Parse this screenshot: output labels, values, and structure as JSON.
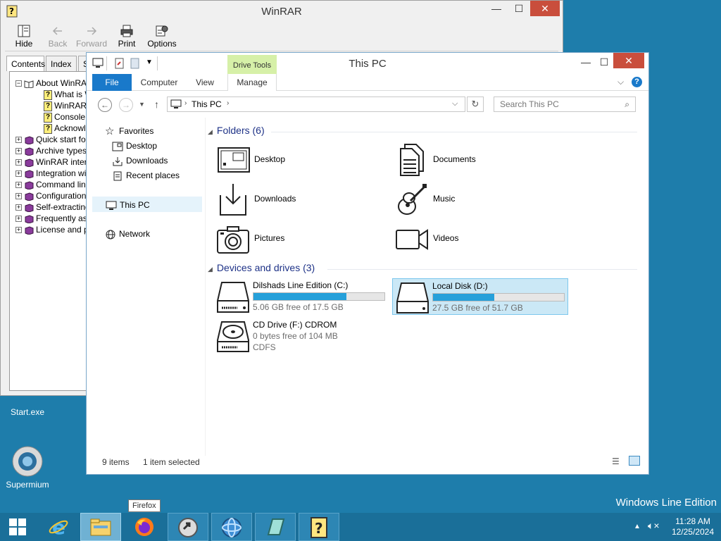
{
  "winrar": {
    "title": "WinRAR",
    "toolbar": [
      {
        "label": "Hide",
        "icon": "hide-icon",
        "enabled": true
      },
      {
        "label": "Back",
        "icon": "back-arrow-icon",
        "enabled": false
      },
      {
        "label": "Forward",
        "icon": "forward-arrow-icon",
        "enabled": false
      },
      {
        "label": "Print",
        "icon": "print-icon",
        "enabled": true
      },
      {
        "label": "Options",
        "icon": "options-icon",
        "enabled": true
      }
    ],
    "tabs": [
      "Contents",
      "Index",
      "Se"
    ],
    "tree": [
      {
        "label": "About WinRA",
        "type": "book-open",
        "expander": "−"
      },
      {
        "label": "What is W",
        "type": "page"
      },
      {
        "label": "WinRAR",
        "type": "page"
      },
      {
        "label": "Console F",
        "type": "page"
      },
      {
        "label": "Acknowle",
        "type": "page"
      },
      {
        "label": "Quick start fo",
        "type": "book",
        "expander": "+"
      },
      {
        "label": "Archive types",
        "type": "book",
        "expander": "+"
      },
      {
        "label": "WinRAR inter",
        "type": "book",
        "expander": "+"
      },
      {
        "label": "Integration wi",
        "type": "book",
        "expander": "+"
      },
      {
        "label": "Command line",
        "type": "book",
        "expander": "+"
      },
      {
        "label": "Configuration",
        "type": "book",
        "expander": "+"
      },
      {
        "label": "Self-extracting",
        "type": "book",
        "expander": "+"
      },
      {
        "label": "Frequently as",
        "type": "book",
        "expander": "+"
      },
      {
        "label": "License and p",
        "type": "book",
        "expander": "+"
      }
    ]
  },
  "explorer": {
    "title": "This PC",
    "context_tab": "Drive Tools",
    "ribbon_tabs": [
      "File",
      "Computer",
      "View",
      "Manage"
    ],
    "address": "This PC",
    "search_placeholder": "Search This PC",
    "nav": {
      "favorites": "Favorites",
      "favorites_items": [
        "Desktop",
        "Downloads",
        "Recent places"
      ],
      "this_pc": "This PC",
      "network": "Network"
    },
    "folders_header": "Folders (6)",
    "folders": [
      {
        "label": "Desktop",
        "icon": "desktop-folder-icon"
      },
      {
        "label": "Documents",
        "icon": "documents-folder-icon"
      },
      {
        "label": "Downloads",
        "icon": "downloads-folder-icon"
      },
      {
        "label": "Music",
        "icon": "music-folder-icon"
      },
      {
        "label": "Pictures",
        "icon": "pictures-folder-icon"
      },
      {
        "label": "Videos",
        "icon": "videos-folder-icon"
      }
    ],
    "devices_header": "Devices and drives (3)",
    "drives": [
      {
        "name": "Dilshads Line Edition (C:)",
        "free": "5.06 GB free of 17.5 GB",
        "used_fraction": 0.71,
        "selected": false
      },
      {
        "name": "Local Disk (D:)",
        "free": "27.5 GB free of 51.7 GB",
        "used_fraction": 0.47,
        "selected": true
      },
      {
        "name": "CD Drive (F:) CDROM",
        "line2": "0 bytes free of 104 MB",
        "line3": "CDFS",
        "selected": false
      }
    ],
    "status": {
      "items": "9 items",
      "selected": "1 item selected"
    }
  },
  "desktop": {
    "icons": [
      {
        "label": "Start.exe"
      },
      {
        "label": "Supermium"
      }
    ],
    "watermark": "Windows Line Edition"
  },
  "taskbar": {
    "tooltip": "Firefox",
    "time": "11:28 AM",
    "date": "12/25/2024",
    "items": [
      "start-button",
      "internet-explorer-icon",
      "file-explorer-icon",
      "firefox-icon",
      "app-icon",
      "browser-globe-icon",
      "notebook-icon",
      "help-icon"
    ]
  },
  "colors": {
    "accent": "#1979ca",
    "desktop": "#1e7dab",
    "drive_bar": "#26a0da",
    "context_tab": "#d6f0a8"
  }
}
